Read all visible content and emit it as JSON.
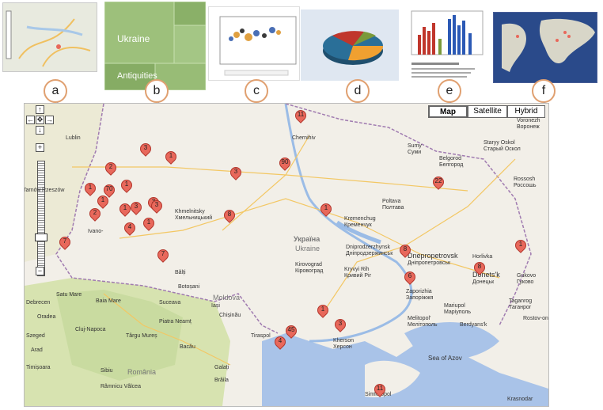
{
  "callouts": [
    "a",
    "b",
    "c",
    "d",
    "e",
    "f"
  ],
  "thumb_b": {
    "title": "Ukraine",
    "subtitle": "Antiquities"
  },
  "map": {
    "map_types": {
      "map": "Map",
      "satellite": "Satellite",
      "hybrid": "Hybrid"
    },
    "countries": {
      "ukraine": "Україна",
      "ukraine_en": "Ukraine",
      "moldova": "Moldova",
      "romania": "România"
    },
    "sea": "Sea of Azov",
    "cities": [
      {
        "name": "Lublin"
      },
      {
        "name": "Tarnów"
      },
      {
        "name": "Rzeszów"
      },
      {
        "name": "Khmelnitsky",
        "alt": "Хмельницький"
      },
      {
        "name": "Ivano-"
      },
      {
        "name": "Chernihiv"
      },
      {
        "name": "Sumy",
        "alt": "Суми"
      },
      {
        "name": "Voronezh",
        "alt": "Воронеж"
      },
      {
        "name": "Staryy Oskol",
        "alt": "Старый Оскол"
      },
      {
        "name": "Belgorod",
        "alt": "Белгород"
      },
      {
        "name": "Rossosh",
        "alt": "Россошь"
      },
      {
        "name": "Poltava",
        "alt": "Полтава"
      },
      {
        "name": "Kremenchug",
        "alt": "Кременчук"
      },
      {
        "name": "Kirovograd",
        "alt": "Кіровоград"
      },
      {
        "name": "Dniprodzerzhynsk",
        "alt": "Дніпродзержинськ"
      },
      {
        "name": "Dnepropetrovsk",
        "alt": "Дніпропетровськ"
      },
      {
        "name": "Kryvyi Rih",
        "alt": "Кривий Ріг"
      },
      {
        "name": "Horlivka"
      },
      {
        "name": "Donets'k",
        "alt": "Донецьк"
      },
      {
        "name": "Gukovo",
        "alt": "Гуково"
      },
      {
        "name": "Taganrog",
        "alt": "Таганрог"
      },
      {
        "name": "Mariupol",
        "alt": "Маріуполь"
      },
      {
        "name": "Berdyans'k"
      },
      {
        "name": "Rostov-on-Don"
      },
      {
        "name": "Melitopol'",
        "alt": "Мелітополь"
      },
      {
        "name": "Kherson",
        "alt": "Херсон"
      },
      {
        "name": "Tiraspol"
      },
      {
        "name": "Chișinău"
      },
      {
        "name": "Bălți"
      },
      {
        "name": "Botoșani"
      },
      {
        "name": "Suceava"
      },
      {
        "name": "Iași"
      },
      {
        "name": "Piatra Neamț"
      },
      {
        "name": "Bacău"
      },
      {
        "name": "Baia Mare"
      },
      {
        "name": "Satu Mare"
      },
      {
        "name": "Oradea"
      },
      {
        "name": "Cluj-Napoca"
      },
      {
        "name": "Târgu Mureș"
      },
      {
        "name": "Sibiu"
      },
      {
        "name": "Timișoara"
      },
      {
        "name": "Râmnicu Vâlcea"
      },
      {
        "name": "Galați"
      },
      {
        "name": "Brăila"
      },
      {
        "name": "Debrecen"
      },
      {
        "name": "Szeged"
      },
      {
        "name": "Arad"
      },
      {
        "name": "Krasnodar"
      },
      {
        "name": "Simferopol"
      },
      {
        "name": "Zaporizhia",
        "alt": "Запоріжжя"
      }
    ],
    "markers": [
      "11",
      "90",
      "3",
      "1",
      "3",
      "2",
      "1",
      "70",
      "1",
      "1",
      "2",
      "3",
      "3",
      "1",
      "4",
      "1",
      "7",
      "7",
      "3",
      "8",
      "1",
      "8",
      "6",
      "8",
      "22",
      "1",
      "1",
      "45",
      "4",
      "3",
      "11",
      "1"
    ]
  }
}
